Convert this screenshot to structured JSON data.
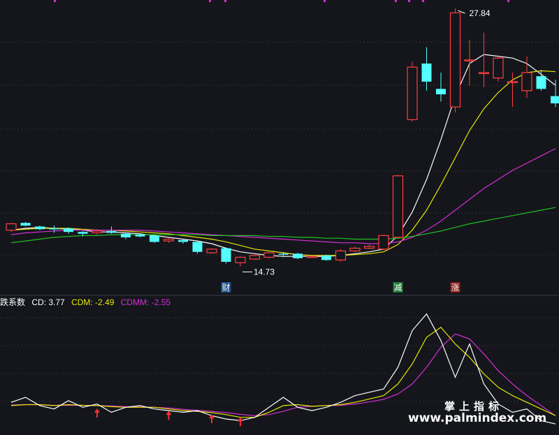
{
  "chart_data": {
    "type": "candlestick",
    "price_range": [
      13.0,
      28.0
    ],
    "annotations": {
      "high_label": "27.84",
      "low_label": "14.73",
      "markers": [
        "财",
        "减",
        "涨"
      ]
    },
    "candles": [
      {
        "o": 15.6,
        "c": 15.95,
        "h": 16.0,
        "l": 15.5
      },
      {
        "o": 16.0,
        "c": 15.85,
        "h": 16.05,
        "l": 15.8
      },
      {
        "o": 15.8,
        "c": 15.65,
        "h": 15.85,
        "l": 15.6
      },
      {
        "o": 15.7,
        "c": 15.65,
        "h": 15.85,
        "l": 15.45
      },
      {
        "o": 15.7,
        "c": 15.5,
        "h": 15.75,
        "l": 15.4
      },
      {
        "o": 15.5,
        "c": 15.4,
        "h": 15.55,
        "l": 15.25
      },
      {
        "o": 15.45,
        "c": 15.55,
        "h": 15.65,
        "l": 15.35
      },
      {
        "o": 15.55,
        "c": 15.45,
        "h": 15.8,
        "l": 15.4
      },
      {
        "o": 15.4,
        "c": 15.2,
        "h": 15.45,
        "l": 15.1
      },
      {
        "o": 15.35,
        "c": 15.25,
        "h": 15.4,
        "l": 15.2
      },
      {
        "o": 15.3,
        "c": 14.95,
        "h": 15.35,
        "l": 14.9
      },
      {
        "o": 15.0,
        "c": 15.1,
        "h": 15.15,
        "l": 14.9
      },
      {
        "o": 15.05,
        "c": 14.95,
        "h": 15.1,
        "l": 14.85
      },
      {
        "o": 14.95,
        "c": 14.4,
        "h": 15.0,
        "l": 14.3
      },
      {
        "o": 14.35,
        "c": 14.55,
        "h": 14.6,
        "l": 14.3
      },
      {
        "o": 14.6,
        "c": 13.85,
        "h": 14.65,
        "l": 13.75
      },
      {
        "o": 13.8,
        "c": 14.1,
        "h": 14.15,
        "l": 13.6
      },
      {
        "o": 14.0,
        "c": 14.2,
        "h": 14.25,
        "l": 13.95
      },
      {
        "o": 14.1,
        "c": 14.35,
        "h": 14.4,
        "l": 14.05
      },
      {
        "o": 14.3,
        "c": 14.25,
        "h": 14.4,
        "l": 14.1
      },
      {
        "o": 14.3,
        "c": 14.05,
        "h": 14.35,
        "l": 14.0
      },
      {
        "o": 14.1,
        "c": 14.15,
        "h": 14.2,
        "l": 14.05
      },
      {
        "o": 14.2,
        "c": 13.95,
        "h": 14.25,
        "l": 13.9
      },
      {
        "o": 13.95,
        "c": 14.45,
        "h": 14.55,
        "l": 13.85
      },
      {
        "o": 14.45,
        "c": 14.6,
        "h": 14.7,
        "l": 14.4
      },
      {
        "o": 14.6,
        "c": 14.7,
        "h": 14.8,
        "l": 14.55
      },
      {
        "o": 14.55,
        "c": 15.3,
        "h": 15.35,
        "l": 14.5
      },
      {
        "o": 15.2,
        "c": 18.6,
        "h": 18.65,
        "l": 15.15
      },
      {
        "o": 21.7,
        "c": 24.6,
        "h": 24.9,
        "l": 21.6
      },
      {
        "o": 24.8,
        "c": 23.8,
        "h": 25.7,
        "l": 23.3
      },
      {
        "o": 23.4,
        "c": 23.1,
        "h": 24.3,
        "l": 22.7
      },
      {
        "o": 22.4,
        "c": 27.6,
        "h": 27.84,
        "l": 22.1
      },
      {
        "o": 25.0,
        "c": 25.0,
        "h": 26.1,
        "l": 23.6
      },
      {
        "o": 24.3,
        "c": 24.3,
        "h": 26.5,
        "l": 23.5
      },
      {
        "o": 24.0,
        "c": 25.1,
        "h": 25.25,
        "l": 23.8
      },
      {
        "o": 23.8,
        "c": 23.8,
        "h": 24.3,
        "l": 22.4
      },
      {
        "o": 23.3,
        "c": 24.3,
        "h": 25.2,
        "l": 22.9
      },
      {
        "o": 24.1,
        "c": 23.4,
        "h": 24.45,
        "l": 23.3
      },
      {
        "o": 23.0,
        "c": 22.6,
        "h": 23.9,
        "l": 22.4
      }
    ],
    "ma_lines": [
      {
        "color": "#ffffff",
        "values": [
          15.6,
          15.7,
          15.75,
          15.7,
          15.65,
          15.6,
          15.5,
          15.5,
          15.45,
          15.4,
          15.3,
          15.2,
          15.1,
          15.0,
          14.85,
          14.6,
          14.4,
          14.3,
          14.2,
          14.15,
          14.15,
          14.15,
          14.15,
          14.2,
          14.3,
          14.4,
          14.55,
          15.3,
          16.6,
          18.4,
          20.6,
          23.0,
          24.8,
          25.3,
          25.2,
          25.1,
          24.8,
          24.2,
          23.6
        ]
      },
      {
        "color": "#e6e600",
        "values": [
          15.6,
          15.65,
          15.7,
          15.7,
          15.7,
          15.65,
          15.6,
          15.6,
          15.55,
          15.5,
          15.45,
          15.4,
          15.3,
          15.2,
          15.1,
          14.95,
          14.75,
          14.55,
          14.45,
          14.35,
          14.25,
          14.2,
          14.2,
          14.2,
          14.25,
          14.3,
          14.4,
          14.8,
          15.6,
          16.7,
          18.1,
          19.6,
          21.1,
          22.3,
          23.2,
          23.9,
          24.3,
          24.4,
          24.35
        ]
      },
      {
        "color": "#d42fd4",
        "values": [
          15.35,
          15.45,
          15.5,
          15.55,
          15.6,
          15.6,
          15.6,
          15.6,
          15.6,
          15.6,
          15.55,
          15.5,
          15.45,
          15.4,
          15.35,
          15.3,
          15.25,
          15.2,
          15.15,
          15.1,
          15.05,
          15.0,
          14.95,
          14.9,
          14.9,
          14.85,
          14.85,
          14.95,
          15.2,
          15.6,
          16.1,
          16.7,
          17.3,
          17.9,
          18.4,
          18.9,
          19.3,
          19.7,
          20.1
        ]
      },
      {
        "color": "#22c022",
        "values": [
          14.9,
          15.0,
          15.1,
          15.2,
          15.25,
          15.3,
          15.3,
          15.35,
          15.35,
          15.35,
          15.35,
          15.35,
          15.35,
          15.35,
          15.3,
          15.3,
          15.3,
          15.3,
          15.25,
          15.25,
          15.2,
          15.2,
          15.15,
          15.15,
          15.1,
          15.1,
          15.1,
          15.15,
          15.25,
          15.4,
          15.55,
          15.75,
          15.95,
          16.1,
          16.25,
          16.4,
          16.55,
          16.7,
          16.85
        ]
      }
    ],
    "indicator": {
      "name": "跌系数",
      "y_range": [
        -6,
        30
      ],
      "legend": [
        {
          "label": "CD: 3.77",
          "color": "#ffffff"
        },
        {
          "label": "CDM: -2.49",
          "color": "#e6e600"
        },
        {
          "label": "CDMM: -2.55",
          "color": "#d42fd4"
        }
      ],
      "cd": [
        1.5,
        3.0,
        0.5,
        -0.5,
        2.0,
        0.0,
        1.0,
        -1.5,
        0.0,
        0.5,
        -0.5,
        -1.0,
        -1.5,
        -1.0,
        -2.5,
        -3.5,
        -4.0,
        -3.0,
        0.0,
        3.0,
        0.0,
        -1.0,
        0.0,
        1.5,
        3.5,
        4.5,
        5.5,
        12.0,
        23.0,
        28.0,
        20.0,
        9.0,
        19.0,
        7.0,
        1.0,
        -1.5,
        -0.5,
        -4.0,
        -5.0
      ],
      "cdm": [
        0.5,
        0.8,
        0.8,
        0.5,
        0.8,
        0.6,
        0.5,
        0.2,
        0.0,
        0.0,
        0.0,
        -0.5,
        -1.0,
        -1.2,
        -1.6,
        -2.2,
        -3.0,
        -3.0,
        -1.5,
        0.5,
        0.8,
        0.3,
        0.5,
        0.8,
        1.5,
        2.5,
        3.5,
        7.0,
        13.0,
        21.0,
        24.0,
        19.0,
        15.0,
        10.0,
        6.0,
        3.5,
        1.5,
        -0.5,
        -2.49
      ],
      "cdmm": [
        0.7,
        0.8,
        0.8,
        0.6,
        0.6,
        0.6,
        0.5,
        0.4,
        0.2,
        0.1,
        0.0,
        -0.2,
        -0.6,
        -0.9,
        -1.2,
        -1.6,
        -2.1,
        -2.5,
        -2.2,
        -1.2,
        0.0,
        0.3,
        0.5,
        0.6,
        1.0,
        1.6,
        2.4,
        4.0,
        7.0,
        12.0,
        18.0,
        22.0,
        20.5,
        16.0,
        11.0,
        7.0,
        3.5,
        0.5,
        -2.55
      ],
      "up_arrows": [
        6,
        11,
        14,
        16
      ]
    }
  },
  "watermark": {
    "line1": "掌上指标",
    "line2": "www.palmindex.com"
  }
}
